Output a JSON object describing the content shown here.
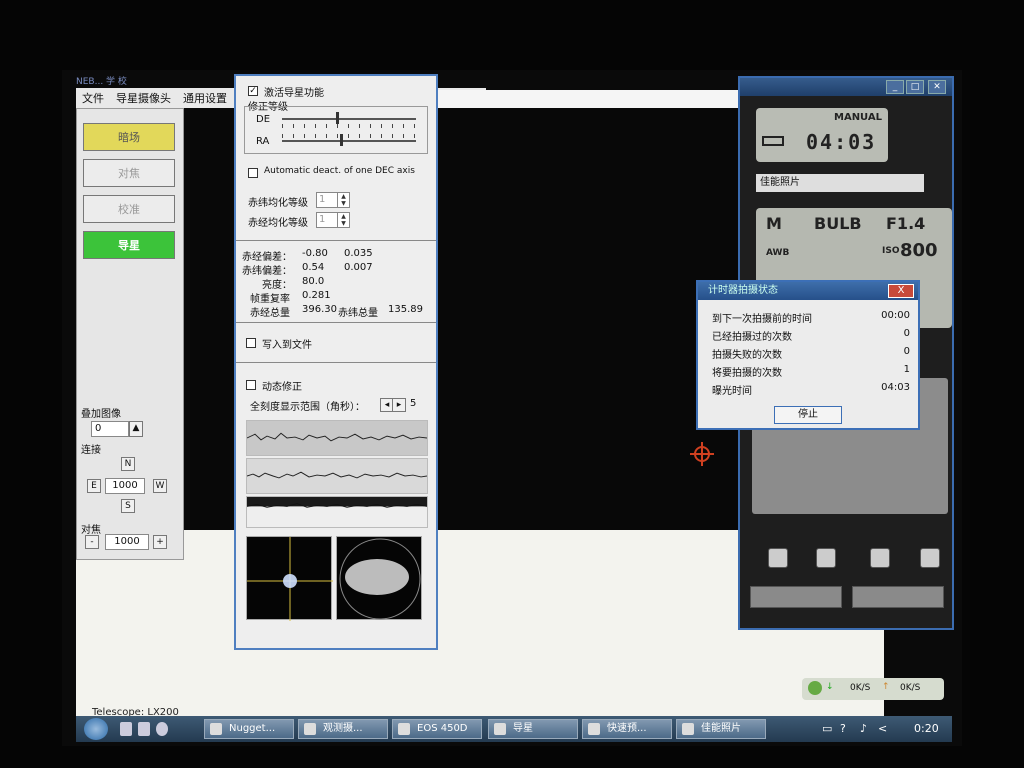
{
  "app": {
    "title": "NEB... 学 校",
    "menu": [
      "文件",
      "导星摄像头",
      "通用设置"
    ]
  },
  "left_panel": {
    "buttons": {
      "dark": "暗场",
      "focus": "对焦",
      "calibrate": "校准",
      "guide": "导星"
    },
    "stack_label": "叠加图像",
    "stack_value": "0",
    "connect_label": "连接",
    "dir": {
      "n": "N",
      "e": "E",
      "w": "W",
      "s": "S"
    },
    "move_value": "1000",
    "focus_label": "对焦",
    "focus_minus": "-",
    "focus_plus": "+",
    "focus_value": "1000"
  },
  "status_text": "Telescope: LX200",
  "guide": {
    "enable_label": "激活导星功能",
    "enable_checked": "✓",
    "correction_group": "修正等级",
    "de_label": "DE",
    "ra_label": "RA",
    "auto_deact_label": "Automatic deact. of one DEC axis",
    "dec_avg_label": "赤纬均化等级",
    "dec_avg_value": "1",
    "ra_avg_label": "赤经均化等级",
    "ra_avg_value": "1",
    "stats": {
      "ra_err_label": "赤经偏差：",
      "ra_err_1": "-0.80",
      "ra_err_2": "0.035",
      "dec_err_label": "赤纬偏差：",
      "dec_err_1": "0.54",
      "dec_err_2": "0.007",
      "brightness_label": "亮度：",
      "brightness": "80.0",
      "repeat_label": "帧重复率",
      "repeat": "0.281",
      "ra_total_label": "赤经总量",
      "ra_total": "396.30",
      "dec_total_label": "赤纬总量",
      "dec_total": "135.89"
    },
    "write_file_label": "写入到文件",
    "dynamic_label": "动态修正",
    "scale_label": "全刻度显示范围（角秒）：",
    "scale_value": "5"
  },
  "camera": {
    "mode": "MANUAL",
    "timer": "04:03",
    "name": "佳能照片",
    "lcd_m": "M",
    "lcd_bulb": "BULB",
    "lcd_f": "F1.4",
    "lcd_iso_label": "ISO",
    "lcd_iso": "800",
    "lcd_awb": "AWB"
  },
  "countdown": {
    "title": "计时器拍摄状态",
    "close": "X",
    "rows": [
      {
        "label": "到下一次拍摄前的时间",
        "value": "00:00"
      },
      {
        "label": "已经拍摄过的次数",
        "value": "0"
      },
      {
        "label": "拍摄失败的次数",
        "value": "0"
      },
      {
        "label": "将要拍摄的次数",
        "value": "1"
      },
      {
        "label": "曝光时间",
        "value": "04:03"
      }
    ],
    "stop": "停止"
  },
  "net": {
    "down": "0K/S",
    "up": "0K/S"
  },
  "taskbar": {
    "tasks": [
      "Nugget...",
      "观测摄...",
      "EOS 450D",
      "导星",
      "快速预...",
      "佳能照片"
    ],
    "clock": "0:20"
  }
}
